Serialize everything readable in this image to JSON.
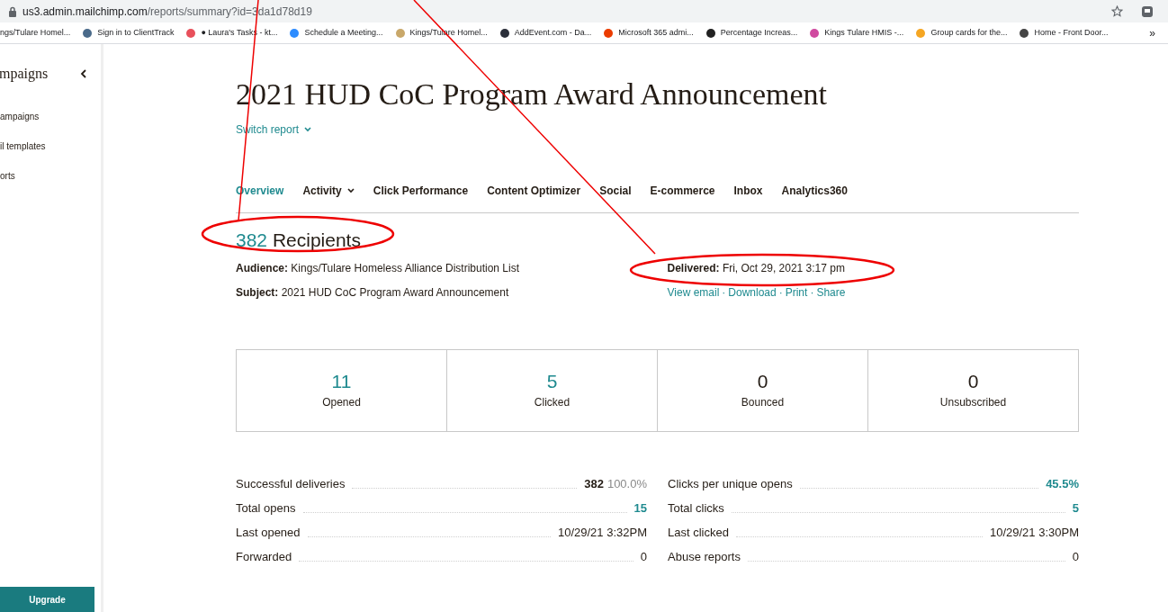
{
  "browser": {
    "url_host": "us3.admin.mailchimp.com",
    "url_path": "/reports/summary?id=3da1d78d19",
    "bookmarks": [
      {
        "label": "ngs/Tulare Homel..."
      },
      {
        "label": "Sign in to ClientTrack",
        "color": "#4a6a8a"
      },
      {
        "label": "● Laura's Tasks - kt...",
        "color": "#e8505b"
      },
      {
        "label": "Schedule a Meeting...",
        "color": "#2d8cff"
      },
      {
        "label": "Kings/Tulare Homel...",
        "color": "#c9a86a"
      },
      {
        "label": "AddEvent.com - Da...",
        "color": "#2b2f3a"
      },
      {
        "label": "Microsoft 365 admi...",
        "color": "#eb3c00"
      },
      {
        "label": "Percentage Increas...",
        "color": "#222222"
      },
      {
        "label": "Kings Tulare HMIS -...",
        "color": "#d04aa0"
      },
      {
        "label": "Group cards for the...",
        "color": "#f5a623"
      },
      {
        "label": "Home - Front Door...",
        "color": "#444444"
      }
    ],
    "overflow": "»"
  },
  "sidebar": {
    "title": "mpaigns",
    "items": [
      "ampaigns",
      "il templates",
      "orts"
    ],
    "upgrade": "Upgrade"
  },
  "report": {
    "title": "2021 HUD CoC Program Award Announcement",
    "switch": "Switch report",
    "tabs": [
      {
        "label": "Overview",
        "selected": true,
        "dropdown": false
      },
      {
        "label": "Activity",
        "selected": false,
        "dropdown": true
      },
      {
        "label": "Click Performance",
        "selected": false,
        "dropdown": false
      },
      {
        "label": "Content Optimizer",
        "selected": false,
        "dropdown": false
      },
      {
        "label": "Social",
        "selected": false,
        "dropdown": false
      },
      {
        "label": "E-commerce",
        "selected": false,
        "dropdown": false
      },
      {
        "label": "Inbox",
        "selected": false,
        "dropdown": false
      },
      {
        "label": "Analytics360",
        "selected": false,
        "dropdown": false
      }
    ],
    "recipients_count": "382",
    "recipients_label": "Recipients",
    "audience_label": "Audience:",
    "audience": "Kings/Tulare Homeless Alliance Distribution List",
    "subject_label": "Subject:",
    "subject": "2021 HUD CoC Program Award Announcement",
    "delivered_label": "Delivered:",
    "delivered": "Fri, Oct 29, 2021 3:17 pm",
    "links": [
      "View email",
      "Download",
      "Print",
      "Share"
    ],
    "separator": "·",
    "stats": [
      {
        "value": "11",
        "label": "Opened",
        "color": "#1f8a8f"
      },
      {
        "value": "5",
        "label": "Clicked",
        "color": "#1f8a8f"
      },
      {
        "value": "0",
        "label": "Bounced",
        "color": "#241c15"
      },
      {
        "value": "0",
        "label": "Unsubscribed",
        "color": "#241c15"
      }
    ],
    "metrics_left": [
      {
        "label": "Successful deliveries",
        "value": "382",
        "extra": "100.0%",
        "linked": false
      },
      {
        "label": "Total opens",
        "value": "15",
        "linked": true
      },
      {
        "label": "Last opened",
        "value": "10/29/21 3:32PM",
        "linked": false
      },
      {
        "label": "Forwarded",
        "value": "0",
        "linked": false
      }
    ],
    "metrics_right": [
      {
        "label": "Clicks per unique opens",
        "value": "45.5%",
        "linked": true
      },
      {
        "label": "Total clicks",
        "value": "5",
        "linked": true
      },
      {
        "label": "Last clicked",
        "value": "10/29/21 3:30PM",
        "linked": false
      },
      {
        "label": "Abuse reports",
        "value": "0",
        "linked": false
      }
    ]
  }
}
